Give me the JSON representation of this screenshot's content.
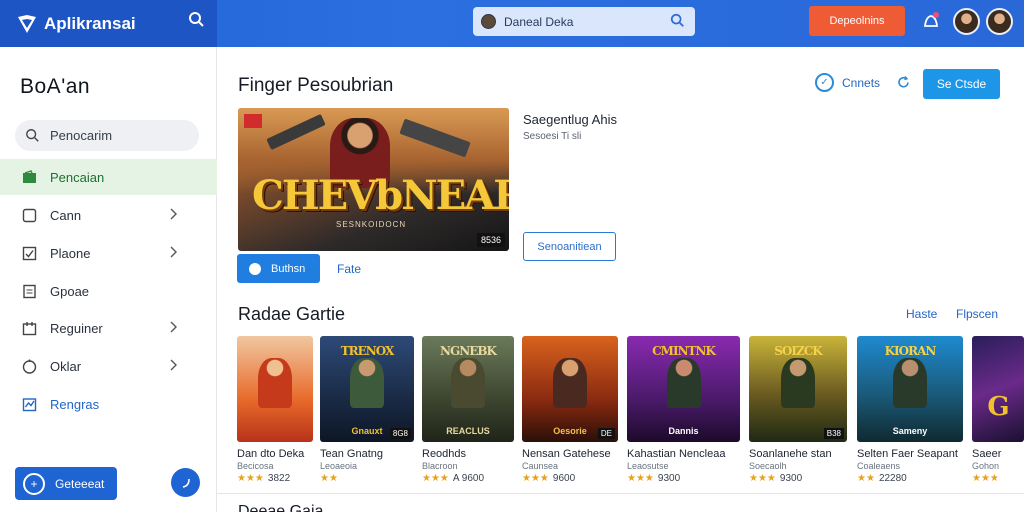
{
  "brand": {
    "name": "Aplikransai",
    "search_icon": "search-icon"
  },
  "topbar": {
    "search_value": "Daneal Deka",
    "cta_label": "Depeolnins",
    "colors": {
      "bar": "#2a6ad9",
      "cta": "#ee5b35"
    }
  },
  "sidebar": {
    "title": "BoA'an",
    "search_placeholder": "Penocarim",
    "items": [
      {
        "label": "Pencaian",
        "icon": "wallet-icon",
        "active": true
      },
      {
        "label": "Cann",
        "icon": "square-icon",
        "chevron": true
      },
      {
        "label": "Plaone",
        "icon": "checkbox-icon"
      },
      {
        "label": "Gpoae",
        "icon": "document-icon"
      },
      {
        "label": "Reguiner",
        "icon": "box-icon",
        "chevron": true
      },
      {
        "label": "Oklar",
        "icon": "circle-icon",
        "chevron": true
      },
      {
        "label": "Rengras",
        "icon": "chart-icon"
      }
    ],
    "bottom_button": "Geteeeat"
  },
  "main": {
    "heading": "Finger Pesoubrian",
    "connect_label": "Cnnets",
    "primary_button": "Se Ctsde",
    "featured": {
      "art_title": "CHEVbNEARI",
      "art_subtitle": "SESNKOIDOCN",
      "corner_tag": "8536",
      "info_title": "Saegentlug Ahis",
      "info_sub": "Sesoesi Ti sli",
      "outline_button": "Senoanitiean",
      "play_button": "Buthsn",
      "secondary_link": "Fate"
    },
    "section_title": "Radae Gartie",
    "section_links": [
      "Haste",
      "Flpscen"
    ],
    "games": [
      {
        "art": "",
        "title": "Dan dto Deka",
        "sub": "Becicosa",
        "stars": "★★★",
        "rating": "3822",
        "corner": ""
      },
      {
        "art": "TRENOX",
        "title": "Tean Gnatng",
        "sub": "Leoaeoia",
        "stars": "★★",
        "rating": "",
        "corner": "8G8",
        "cap": "Gnauxt"
      },
      {
        "art": "NGNEBK",
        "title": "Reodhds",
        "sub": "Blacroon",
        "stars": "★★★",
        "rating": "A 9600",
        "corner": "",
        "cap": "REACLUS"
      },
      {
        "art": "",
        "title": "Nensan Gatehese",
        "sub": "Caunsea",
        "stars": "★★★",
        "rating": "9600",
        "corner": "DE",
        "cap": "Oesorie"
      },
      {
        "art": "CMINTNK",
        "title": "Kahastian Nencleaa",
        "sub": "Leaosutse",
        "stars": "★★★",
        "rating": "9300",
        "corner": "",
        "cap": "Dannis"
      },
      {
        "art": "SOIZCK",
        "title": "Soanlanehe stan",
        "sub": "Soecaolh",
        "stars": "★★★",
        "rating": "9300",
        "corner": "B38",
        "cap": ""
      },
      {
        "art": "KIORAN",
        "title": "Selten Faer Seapant",
        "sub": "Coaleaens",
        "stars": "★★",
        "rating": "22280",
        "corner": "",
        "cap": "Sameny"
      },
      {
        "art": "G",
        "title": "Saeer",
        "sub": "Gohon",
        "stars": "★★★",
        "rating": "",
        "corner": "",
        "cap": ""
      }
    ],
    "bottom_heading": "Deeae Gaia"
  }
}
